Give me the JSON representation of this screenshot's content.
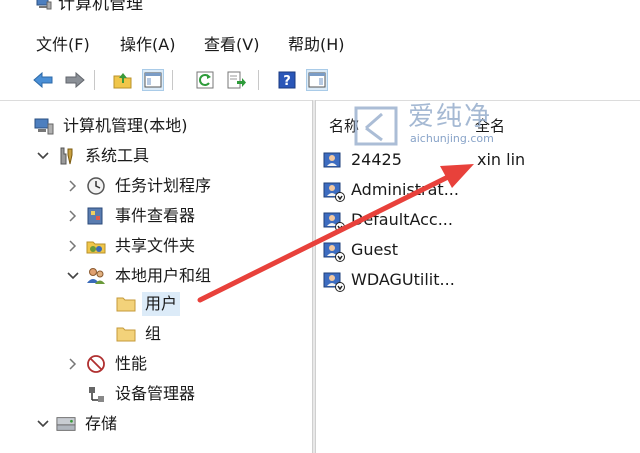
{
  "window": {
    "title": "计算机管理"
  },
  "menu": [
    {
      "label": "文件(F)"
    },
    {
      "label": "操作(A)"
    },
    {
      "label": "查看(V)"
    },
    {
      "label": "帮助(H)"
    }
  ],
  "toolbar": {
    "buttons": [
      {
        "icon": "back-arrow-icon"
      },
      {
        "icon": "forward-arrow-icon"
      },
      {
        "icon": "up-folder-icon"
      },
      {
        "icon": "show-hide-console-tree-icon"
      },
      {
        "icon": "refresh-icon"
      },
      {
        "icon": "export-list-icon"
      },
      {
        "icon": "help-icon"
      },
      {
        "icon": "show-action-pane-icon"
      }
    ]
  },
  "tree": {
    "root": {
      "label": "计算机管理(本地)",
      "icon": "computer-management-icon"
    },
    "system_tools": {
      "label": "系统工具",
      "icon": "tools-icon"
    },
    "task_scheduler": {
      "label": "任务计划程序",
      "icon": "clock-icon"
    },
    "event_viewer": {
      "label": "事件查看器",
      "icon": "event-viewer-icon"
    },
    "shared_folders": {
      "label": "共享文件夹",
      "icon": "shared-folder-icon"
    },
    "local_users": {
      "label": "本地用户和组",
      "icon": "users-group-icon"
    },
    "users": {
      "label": "用户",
      "icon": "folder-icon"
    },
    "groups": {
      "label": "组",
      "icon": "folder-icon"
    },
    "performance": {
      "label": "性能",
      "icon": "performance-icon"
    },
    "device_manager": {
      "label": "设备管理器",
      "icon": "device-manager-icon"
    },
    "storage": {
      "label": "存储",
      "icon": "storage-icon"
    }
  },
  "list": {
    "columns": {
      "name": "名称",
      "fullname": "全名"
    },
    "rows": [
      {
        "name": "24425",
        "fullname": "xin lin"
      },
      {
        "name": "Administrat...",
        "fullname": ""
      },
      {
        "name": "DefaultAcc...",
        "fullname": ""
      },
      {
        "name": "Guest",
        "fullname": ""
      },
      {
        "name": "WDAGUtilit...",
        "fullname": ""
      }
    ]
  },
  "watermark": {
    "text": "爱纯净",
    "url": "aichunjing.com"
  },
  "colors": {
    "selection": "#dcebf8",
    "annotation_arrow": "#e8413b",
    "watermark": "#9cb2cf"
  }
}
